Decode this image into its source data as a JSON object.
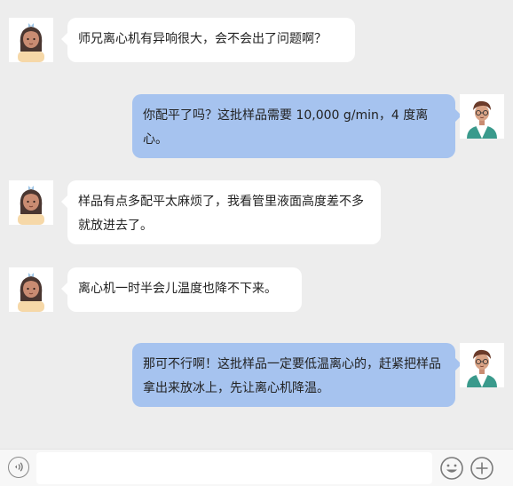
{
  "conversation": {
    "messages": [
      {
        "side": "left",
        "sender": "girl",
        "text": "师兄离心机有异响很大，会不会出了问题啊？"
      },
      {
        "side": "right",
        "sender": "boy",
        "text": "你配平了吗？这批样品需要 10,000 g/min，4 度离心。"
      },
      {
        "side": "left",
        "sender": "girl",
        "text": "样品有点多配平太麻烦了，我看管里液面高度差不多就放进去了。"
      },
      {
        "side": "left",
        "sender": "girl",
        "text": "离心机一时半会儿温度也降不下来。"
      },
      {
        "side": "right",
        "sender": "boy",
        "text": "那可不行啊！这批样品一定要低温离心的，赶紧把样品拿出来放冰上，先让离心机降温。"
      }
    ]
  },
  "input_bar": {
    "voice_icon": "voice-icon",
    "emoji_icon": "emoji-icon",
    "plus_icon": "plus-icon",
    "text_value": ""
  },
  "colors": {
    "background": "#ededed",
    "left_bubble": "#ffffff",
    "right_bubble": "#a6c3ef"
  }
}
